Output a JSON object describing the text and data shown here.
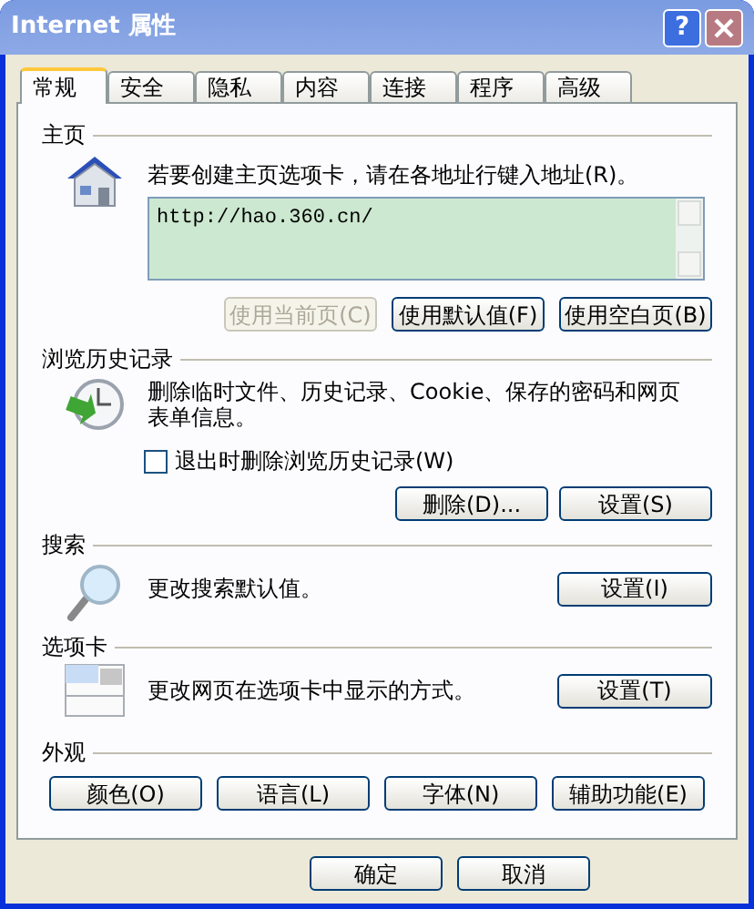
{
  "window": {
    "title": "Internet 属性",
    "help": "?"
  },
  "tabs": [
    {
      "label": "常规",
      "selected": true
    },
    {
      "label": "安全",
      "selected": false
    },
    {
      "label": "隐私",
      "selected": false
    },
    {
      "label": "内容",
      "selected": false
    },
    {
      "label": "连接",
      "selected": false
    },
    {
      "label": "程序",
      "selected": false
    },
    {
      "label": "高级",
      "selected": false
    }
  ],
  "sections": [
    {
      "kind": "homepage",
      "title": "主页",
      "description": "若要创建主页选项卡，请在各地址行键入地址(R)。",
      "address": "http://hao.360.cn/",
      "buttons": [
        {
          "label": "使用当前页(C)",
          "disabled": true
        },
        {
          "label": "使用默认值(F)",
          "disabled": false
        },
        {
          "label": "使用空白页(B)",
          "disabled": false
        }
      ]
    },
    {
      "kind": "history",
      "title": "浏览历史记录",
      "description": "删除临时文件、历史记录、Cookie、保存的密码和网页表单信息。",
      "checkbox": {
        "label": "退出时删除浏览历史记录(W)",
        "checked": false
      },
      "buttons": [
        {
          "label": "删除(D)...",
          "disabled": false
        },
        {
          "label": "设置(S)",
          "disabled": false
        }
      ]
    },
    {
      "kind": "search",
      "title": "搜索",
      "description": "更改搜索默认值。",
      "buttons": [
        {
          "label": "设置(I)",
          "disabled": false
        }
      ]
    },
    {
      "kind": "tabs",
      "title": "选项卡",
      "description": "更改网页在选项卡中显示的方式。",
      "buttons": [
        {
          "label": "设置(T)",
          "disabled": false
        }
      ]
    },
    {
      "kind": "appearance",
      "title": "外观",
      "buttons": [
        {
          "label": "颜色(O)",
          "disabled": false
        },
        {
          "label": "语言(L)",
          "disabled": false
        },
        {
          "label": "字体(N)",
          "disabled": false
        },
        {
          "label": "辅助功能(E)",
          "disabled": false
        }
      ]
    }
  ],
  "footer_buttons": [
    {
      "label": "确定",
      "disabled": false
    },
    {
      "label": "取消",
      "disabled": false
    }
  ]
}
